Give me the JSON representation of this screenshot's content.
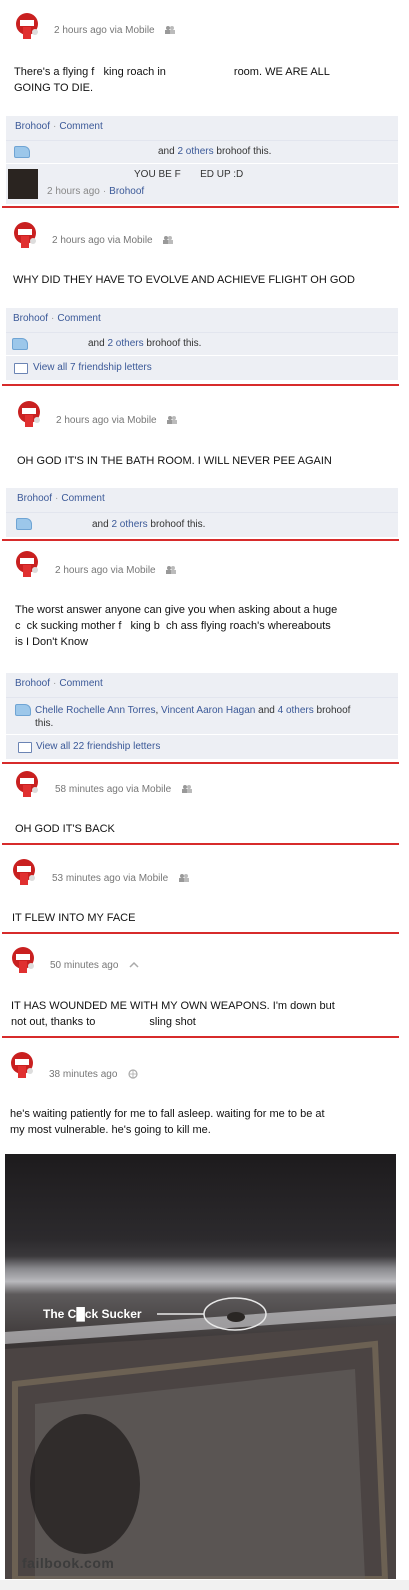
{
  "posts": [
    {
      "timestamp": "2 hours ago via Mobile",
      "status_line1": "There's a flying f   king roach in",
      "status_line1_rest": "room. WE ARE ALL",
      "status_line2": "GOING TO DIE.",
      "brohoof_label": "Brohoof",
      "comment_label": "Comment",
      "likes_others": "2 others",
      "likes_suffix": "brohoof this.",
      "likes_and": "and",
      "comment_text": "YOU BE F       ED UP :D",
      "comment_time": "2 hours ago",
      "comment_brohoof": "Brohoof"
    },
    {
      "timestamp": "2 hours ago via Mobile",
      "status": "WHY DID THEY HAVE TO EVOLVE AND ACHIEVE FLIGHT OH GOD",
      "brohoof_label": "Brohoof",
      "comment_label": "Comment",
      "likes_and": "and",
      "likes_others": "2 others",
      "likes_suffix": "brohoof this.",
      "view_all": "View all 7 friendship letters"
    },
    {
      "timestamp": "2 hours ago via Mobile",
      "status": "OH GOD IT'S IN THE BATH ROOM. I WILL NEVER PEE AGAIN",
      "brohoof_label": "Brohoof",
      "comment_label": "Comment",
      "likes_and": "and",
      "likes_others": "2 others",
      "likes_suffix": "brohoof this."
    },
    {
      "timestamp": "2 hours ago via Mobile",
      "status_line1": "The worst answer anyone can give you when asking about a huge",
      "status_line2": "c  ck sucking mother f   king b  ch ass flying roach's whereabouts",
      "status_line3": "is I Don't Know",
      "brohoof_label": "Brohoof",
      "comment_label": "Comment",
      "liker1": "Chelle Rochelle Ann Torres",
      "liker2": "Vincent Aaron Hagan",
      "likes_and": "and",
      "likes_others": "4 others",
      "likes_suffix": "brohoof",
      "likes_suffix2": "this.",
      "view_all": "View all 22 friendship letters"
    },
    {
      "timestamp": "58 minutes ago via Mobile",
      "status": "OH GOD IT'S BACK"
    },
    {
      "timestamp": "53 minutes ago via Mobile",
      "status": "IT FLEW INTO MY FACE"
    },
    {
      "timestamp": "50 minutes ago",
      "status_line1": "IT HAS WOUNDED ME WITH MY OWN WEAPONS. I'm down but",
      "status_line2a": "not out, thanks to",
      "status_line2b": "sling shot"
    },
    {
      "timestamp": "38 minutes ago",
      "status_line1": "he's waiting patiently for me to fall asleep. waiting for me to be at",
      "status_line2": "my most vulnerable. he's going to kill me."
    }
  ],
  "photo": {
    "annotation": "The C█ck Sucker"
  },
  "footer": {
    "site": "failbook.com"
  },
  "colors": {
    "divider": "#d72b2b",
    "link": "#3b5998",
    "panel": "#edeff4"
  }
}
